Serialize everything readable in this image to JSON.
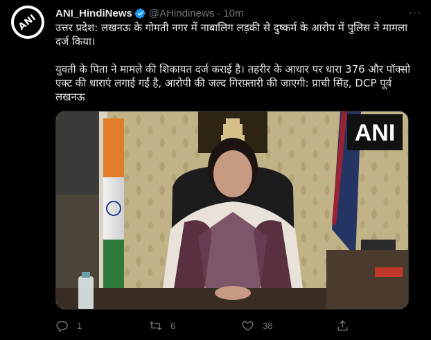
{
  "tweet": {
    "author_name": "ANI_HindiNews",
    "handle": "@AHindinews",
    "separator": "·",
    "time": "10m",
    "avatar_text": "ANI",
    "more_label": "···",
    "paragraphs": [
      "उत्तर प्रदेश: लखनऊ के गोमती नगर में नाबालिग लड़की से दुष्कर्म के आरोप में पुलिस ने मामला दर्ज किया।",
      "युवती के पिता ने मामले की शिकायत दर्ज कराई है। तहरीर के आधार पर धारा 376 और पॉक्सो एक्ट की धाराएं लगाई गईं है, आरोपी की जल्द गिरफ़्तारी की जाएगी: प्राची सिंह, DCP पूर्व लखनऊ"
    ]
  },
  "media": {
    "watermark": "ANI"
  },
  "actions": {
    "replies": "1",
    "retweets": "6",
    "likes": "38"
  },
  "colors": {
    "background": "#000000",
    "text": "#e7e9ea",
    "muted": "#71767b",
    "verified": "#1d9bf0"
  }
}
